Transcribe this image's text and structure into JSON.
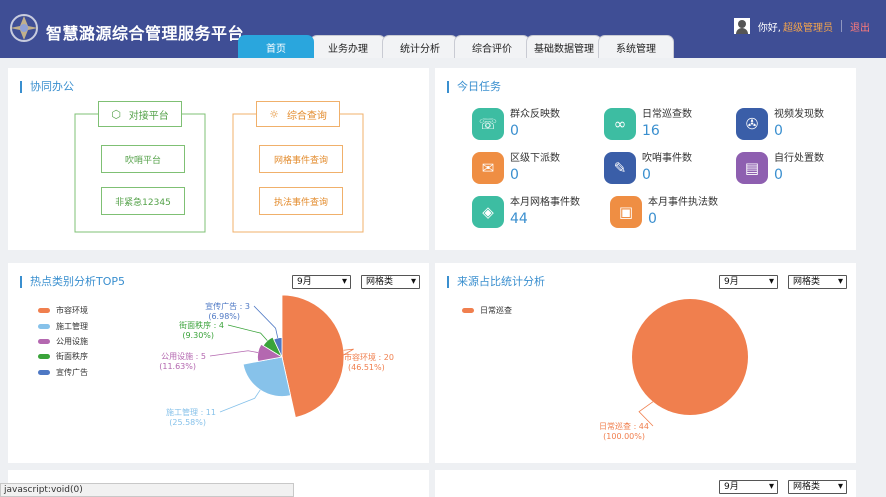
{
  "header": {
    "title": "智慧潞源综合管理服务平台",
    "greeting": "你好,",
    "user_name": "超级管理员",
    "logout_label": "退出",
    "tabs": [
      {
        "label": "首页",
        "active": true
      },
      {
        "label": "业务办理",
        "active": false
      },
      {
        "label": "统计分析",
        "active": false
      },
      {
        "label": "综合评价",
        "active": false
      },
      {
        "label": "基础数据管理",
        "active": false
      },
      {
        "label": "系统管理",
        "active": false
      }
    ]
  },
  "office": {
    "title": "协同办公",
    "left_group": {
      "title": "对接平台",
      "icon": "cube-icon",
      "buttons": [
        "吹哨平台",
        "非紧急12345"
      ]
    },
    "right_group": {
      "title": "综合查询",
      "icon": "bulb-icon",
      "buttons": [
        "网格事件查询",
        "执法事件查询"
      ]
    }
  },
  "tasks": {
    "title": "今日任务",
    "items": [
      {
        "label": "群众反映数",
        "count": "0",
        "icon": "phone-icon",
        "color": "#3dbda2"
      },
      {
        "label": "日常巡查数",
        "count": "16",
        "icon": "binoculars-icon",
        "color": "#3dbda2"
      },
      {
        "label": "视频发现数",
        "count": "0",
        "icon": "film-icon",
        "color": "#3a5ea8"
      },
      {
        "label": "区级下派数",
        "count": "0",
        "icon": "mail-icon",
        "color": "#ef8e43"
      },
      {
        "label": "吹哨事件数",
        "count": "0",
        "icon": "pencil-icon",
        "color": "#3a5ea8"
      },
      {
        "label": "自行处置数",
        "count": "0",
        "icon": "contact-card-icon",
        "color": "#8e5fb0"
      },
      {
        "label": "本月网格事件数",
        "count": "44",
        "icon": "layers-icon",
        "color": "#3dbda2"
      },
      {
        "label": "本月事件执法数",
        "count": "0",
        "icon": "clipboard-icon",
        "color": "#ef8e43"
      }
    ]
  },
  "hotspot": {
    "title": "热点类别分析TOP5",
    "month_select": "9月",
    "type_select": "网格类"
  },
  "source": {
    "title": "来源占比统计分析",
    "month_select": "9月",
    "type_select": "网格类"
  },
  "bottom": {
    "month_select": "9月",
    "type_select": "网格类"
  },
  "chart_data": [
    {
      "type": "pie",
      "title": "热点类别分析TOP5",
      "legend_position": "left",
      "series": [
        {
          "name": "市容环境",
          "value": 20,
          "percent": "46.51%",
          "color": "#f07f4e"
        },
        {
          "name": "施工管理",
          "value": 11,
          "percent": "25.58%",
          "color": "#87c2ea"
        },
        {
          "name": "公用设施",
          "value": 5,
          "percent": "11.63%",
          "color": "#b468b0"
        },
        {
          "name": "街面秩序",
          "value": 4,
          "percent": "9.30%",
          "color": "#3aa33a"
        },
        {
          "name": "宣传广告",
          "value": 3,
          "percent": "6.98%",
          "color": "#4e78c4"
        }
      ]
    },
    {
      "type": "pie",
      "title": "来源占比统计分析",
      "legend_position": "top-left",
      "series": [
        {
          "name": "日常巡查",
          "value": 44,
          "percent": "100.00%",
          "color": "#f07f4e"
        }
      ]
    }
  ],
  "statusbar": {
    "text": "javascript:void(0)"
  }
}
